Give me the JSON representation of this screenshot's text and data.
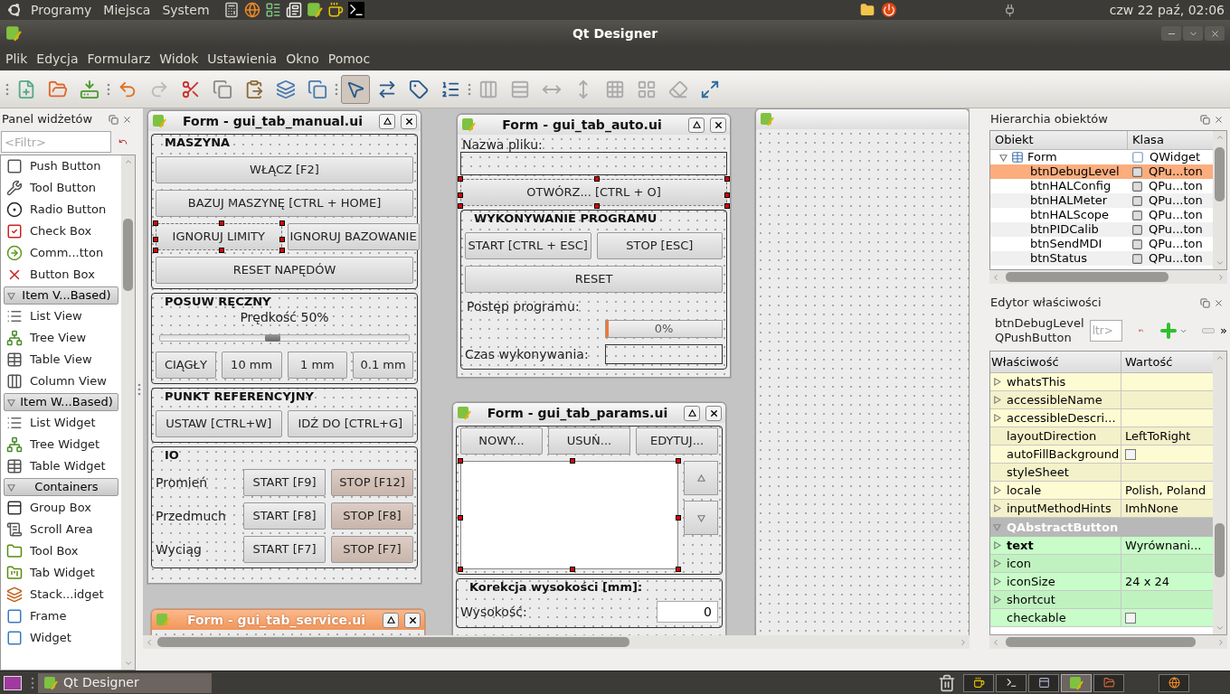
{
  "top_panel": {
    "menus": [
      "Programy",
      "Miejsca",
      "System"
    ],
    "clock": "czw 22 paź, 02:06"
  },
  "window": {
    "title": "Qt Designer"
  },
  "menu_bar": [
    "Plik",
    "Edycja",
    "Formularz",
    "Widok",
    "Ustawienia",
    "Okno",
    "Pomoc"
  ],
  "toolbar": {
    "modes": [
      {
        "selected": true
      },
      {
        "selected": false
      },
      {
        "selected": false
      },
      {
        "selected": false
      }
    ]
  },
  "widget_box": {
    "title": "Panel widżetów",
    "filter": {
      "placeholder": "<Filtr>"
    },
    "items": [
      {
        "kind": "widget",
        "label": "Push Button"
      },
      {
        "kind": "widget",
        "label": "Tool Button"
      },
      {
        "kind": "widget",
        "label": "Radio Button"
      },
      {
        "kind": "widget",
        "label": "Check Box"
      },
      {
        "kind": "widget",
        "label": "Comm...tton"
      },
      {
        "kind": "widget",
        "label": "Button Box"
      },
      {
        "kind": "category",
        "label": "Item V...Based)",
        "expanded": true
      },
      {
        "kind": "widget",
        "label": "List View"
      },
      {
        "kind": "widget",
        "label": "Tree View"
      },
      {
        "kind": "widget",
        "label": "Table View"
      },
      {
        "kind": "widget",
        "label": "Column View"
      },
      {
        "kind": "category",
        "label": "Item W...Based)",
        "expanded": true
      },
      {
        "kind": "widget",
        "label": "List Widget"
      },
      {
        "kind": "widget",
        "label": "Tree Widget"
      },
      {
        "kind": "widget",
        "label": "Table Widget"
      },
      {
        "kind": "category",
        "label": "Containers",
        "expanded": true
      },
      {
        "kind": "widget",
        "label": "Group Box"
      },
      {
        "kind": "widget",
        "label": "Scroll Area"
      },
      {
        "kind": "widget",
        "label": "Tool Box"
      },
      {
        "kind": "widget",
        "label": "Tab Widget"
      },
      {
        "kind": "widget",
        "label": "Stack...idget"
      },
      {
        "kind": "widget",
        "label": "Frame"
      },
      {
        "kind": "widget",
        "label": "Widget"
      }
    ]
  },
  "forms": [
    {
      "title": "Form - gui_tab_manual.ui",
      "active": false,
      "body": [
        {
          "kind": "group",
          "title": "MASZYNA",
          "blocks": [
            {
              "kind": "row",
              "cells": [
                {
                  "kind": "button",
                  "label": "WŁĄCZ [F2]",
                  "selected": false
                }
              ]
            },
            {
              "kind": "row",
              "cells": [
                {
                  "kind": "button",
                  "label": "BAZUJ MASZYNĘ [CTRL + HOME]",
                  "selected": false
                }
              ]
            },
            {
              "kind": "row",
              "cells": [
                {
                  "kind": "button",
                  "label": "IGNORUJ LIMITY",
                  "selected": true
                },
                {
                  "kind": "button",
                  "label": "IGNORUJ BAZOWANIE",
                  "selected": false
                }
              ]
            },
            {
              "kind": "row",
              "cells": [
                {
                  "kind": "button",
                  "label": "RESET NAPĘDÓW",
                  "selected": false
                }
              ]
            }
          ]
        },
        {
          "kind": "group",
          "title": "POSUW RĘCZNY",
          "blocks": [
            {
              "kind": "caption",
              "text": "Prędkość 50%"
            },
            {
              "kind": "slider",
              "level": 0.45
            },
            {
              "kind": "row",
              "cells": [
                {
                  "kind": "button",
                  "label": "CIĄGŁY",
                  "selected": false
                },
                {
                  "kind": "button",
                  "label": "10 mm",
                  "selected": false
                },
                {
                  "kind": "button",
                  "label": "1 mm",
                  "selected": false
                },
                {
                  "kind": "button",
                  "label": "0.1 mm",
                  "selected": false
                }
              ]
            }
          ]
        },
        {
          "kind": "group",
          "title": "PUNKT REFERENCYJNY",
          "blocks": [
            {
              "kind": "row",
              "cells": [
                {
                  "kind": "button",
                  "label": "USTAW  [CTRL+W]",
                  "selected": false
                },
                {
                  "kind": "button",
                  "label": "IDŹ DO  [CTRL+G]",
                  "selected": false
                }
              ]
            }
          ]
        },
        {
          "kind": "group",
          "title": "IO",
          "blocks": [
            {
              "kind": "row",
              "cells": [
                {
                  "kind": "label",
                  "text": "Promień"
                },
                {
                  "kind": "button",
                  "label": "START [F9]",
                  "selected": false
                },
                {
                  "kind": "tinted-button",
                  "label": "STOP [F12]",
                  "selected": false
                }
              ]
            },
            {
              "kind": "row",
              "cells": [
                {
                  "kind": "label",
                  "text": "Przedmuch"
                },
                {
                  "kind": "button",
                  "label": "START [F8]",
                  "selected": false
                },
                {
                  "kind": "tinted-button",
                  "label": "STOP [F8]",
                  "selected": false
                }
              ]
            },
            {
              "kind": "row",
              "cells": [
                {
                  "kind": "label",
                  "text": "Wyciąg"
                },
                {
                  "kind": "button",
                  "label": "START [F7]",
                  "selected": false
                },
                {
                  "kind": "tinted-button",
                  "label": "STOP [F7]",
                  "selected": false
                }
              ]
            }
          ]
        }
      ]
    },
    {
      "title": "Form - gui_tab_auto.ui",
      "active": false,
      "body": [
        {
          "kind": "label",
          "text": "Nazwa pliku:"
        },
        {
          "kind": "field"
        },
        {
          "kind": "row",
          "cells": [
            {
              "kind": "button",
              "label": "OTWÓRZ... [CTRL + O]",
              "selected": true
            }
          ]
        },
        {
          "kind": "group",
          "title": "WYKONYWANIE PROGRAMU",
          "blocks": [
            {
              "kind": "row",
              "cells": [
                {
                  "kind": "button",
                  "label": "START [CTRL + ESC]",
                  "selected": false
                },
                {
                  "kind": "button",
                  "label": "STOP [ESC]",
                  "selected": false
                }
              ]
            },
            {
              "kind": "row",
              "cells": [
                {
                  "kind": "button",
                  "label": "RESET",
                  "selected": false
                }
              ]
            },
            {
              "kind": "label",
              "text": "Postęp programu:"
            },
            {
              "kind": "row",
              "cells": [
                {
                  "kind": "spacer"
                },
                {
                  "kind": "progress",
                  "level": 0,
                  "text": "0%"
                }
              ]
            },
            {
              "kind": "row",
              "cells": [
                {
                  "kind": "label",
                  "text": "Czas wykonywania:"
                },
                {
                  "kind": "frame"
                }
              ]
            }
          ]
        }
      ]
    },
    {
      "title": "Form - gui_tab_params.ui",
      "active": false,
      "body": [
        {
          "kind": "group",
          "blocks": [
            {
              "kind": "row",
              "cells": [
                {
                  "kind": "button",
                  "label": "NOWY...",
                  "selected": false
                },
                {
                  "kind": "button",
                  "label": "USUŃ...",
                  "selected": false
                },
                {
                  "kind": "button",
                  "label": "EDYTUJ...",
                  "selected": false
                }
              ]
            },
            {
              "kind": "list-row",
              "selected": true
            }
          ]
        },
        {
          "kind": "group",
          "title": "Korekcja wysokości [mm]:",
          "blocks": [
            {
              "kind": "row",
              "cells": [
                {
                  "kind": "label",
                  "text": "Wysokość:"
                },
                {
                  "kind": "spin",
                  "value": "0"
                }
              ]
            }
          ]
        }
      ]
    },
    {
      "title": "Form - gui_tab_service.ui",
      "active": true
    }
  ],
  "object_inspector": {
    "title": "Hierarchia obiektów",
    "columns": [
      "Obiekt",
      "Klasa"
    ],
    "rows": [
      {
        "name": "Form",
        "class": "QWidget",
        "expanded": true,
        "selected": false,
        "children": [
          {
            "name": "btnDebugLevel",
            "class": "QPu...ton",
            "selected": true
          },
          {
            "name": "btnHALConfig",
            "class": "QPu...ton",
            "selected": false
          },
          {
            "name": "btnHALMeter",
            "class": "QPu...ton",
            "selected": false
          },
          {
            "name": "btnHALScope",
            "class": "QPu...ton",
            "selected": false
          },
          {
            "name": "btnPIDCalib",
            "class": "QPu...ton",
            "selected": false
          },
          {
            "name": "btnSendMDI",
            "class": "QPu...ton",
            "selected": false
          },
          {
            "name": "btnStatus",
            "class": "QPu...ton",
            "selected": false
          }
        ]
      }
    ]
  },
  "property_editor": {
    "title": "Edytor właściwości",
    "object_name": "btnDebugLevel",
    "object_class": "QPushButton",
    "filter": {
      "placeholder": "ltr>"
    },
    "more": "»",
    "columns": [
      "Właściwość",
      "Wartość"
    ],
    "groups": [
      {
        "color": "#fdfbd2",
        "rows": [
          {
            "name": "whatsThis",
            "kind": "text",
            "expandable": true,
            "modified": false
          },
          {
            "name": "accessibleName",
            "kind": "text",
            "expandable": true,
            "modified": false
          },
          {
            "name": "accessibleDescri...",
            "kind": "text",
            "expandable": true,
            "modified": false
          },
          {
            "name": "layoutDirection",
            "kind": "text",
            "value": "LeftToRight",
            "expandable": false,
            "modified": false
          },
          {
            "name": "autoFillBackground",
            "kind": "checkbox",
            "checked": false,
            "expandable": false,
            "modified": false
          },
          {
            "name": "styleSheet",
            "kind": "text",
            "expandable": false,
            "modified": false
          },
          {
            "name": "locale",
            "kind": "text",
            "value": "Polish, Poland",
            "expandable": true,
            "modified": false
          },
          {
            "name": "inputMethodHints",
            "kind": "text",
            "value": "ImhNone",
            "expandable": true,
            "modified": false
          }
        ]
      },
      {
        "title": "QAbstractButton",
        "expanded": true,
        "color": "#c8fcc8",
        "rows": [
          {
            "name": "text",
            "kind": "text",
            "value": "Wyrównani...",
            "expandable": true,
            "modified": true
          },
          {
            "name": "icon",
            "kind": "text",
            "expandable": true,
            "modified": false
          },
          {
            "name": "iconSize",
            "kind": "text",
            "value": "24 x 24",
            "expandable": true,
            "modified": false
          },
          {
            "name": "shortcut",
            "kind": "text",
            "expandable": true,
            "modified": false
          },
          {
            "name": "checkable",
            "kind": "checkbox",
            "checked": false,
            "expandable": false,
            "modified": false
          }
        ]
      }
    ]
  },
  "taskbar": {
    "tasks": [
      {
        "label": "Qt Designer"
      }
    ]
  }
}
